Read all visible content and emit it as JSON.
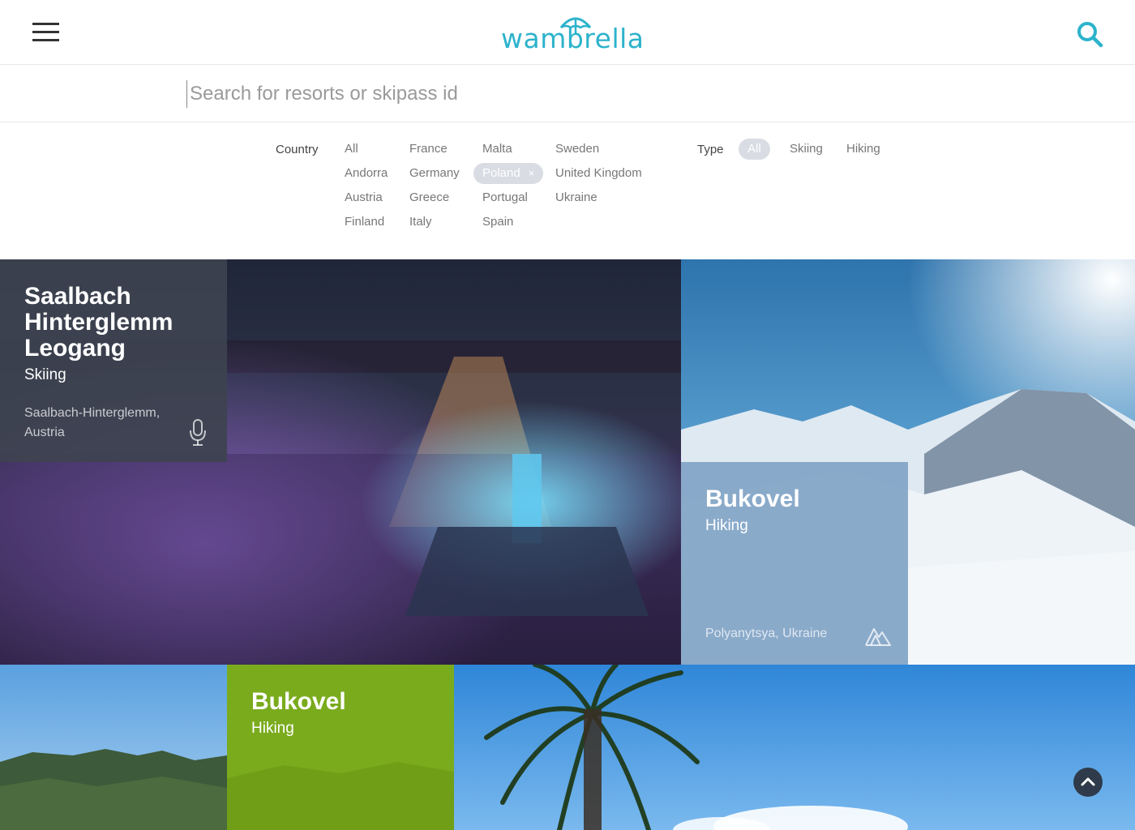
{
  "header": {
    "logo_text": "wambrella",
    "menu_icon": "hamburger-icon",
    "search_icon": "search-icon",
    "accent_color": "#2db3cc"
  },
  "search": {
    "placeholder": "Search for resorts or skipass id",
    "value": ""
  },
  "filters": {
    "country_label": "Country",
    "countries": [
      {
        "label": "All",
        "selected": false
      },
      {
        "label": "Andorra",
        "selected": false
      },
      {
        "label": "Austria",
        "selected": false
      },
      {
        "label": "Finland",
        "selected": false
      },
      {
        "label": "France",
        "selected": false
      },
      {
        "label": "Germany",
        "selected": false
      },
      {
        "label": "Greece",
        "selected": false
      },
      {
        "label": "Italy",
        "selected": false
      },
      {
        "label": "Malta",
        "selected": false
      },
      {
        "label": "Poland",
        "selected": true
      },
      {
        "label": "Portugal",
        "selected": false
      },
      {
        "label": "Spain",
        "selected": false
      },
      {
        "label": "Sweden",
        "selected": false
      },
      {
        "label": "United Kingdom",
        "selected": false
      },
      {
        "label": "Ukraine",
        "selected": false
      }
    ],
    "remove_glyph": "×",
    "type_label": "Type",
    "types": [
      {
        "label": "All",
        "selected": true
      },
      {
        "label": "Skiing",
        "selected": false
      },
      {
        "label": "Hiking",
        "selected": false
      }
    ]
  },
  "resorts": [
    {
      "name": "Saalbach Hinterglemm Leogang",
      "type": "Skiing",
      "location": "Saalbach-Hinterglemm, Austria",
      "icon": "microphone-icon",
      "card_color": "#3d4350"
    },
    {
      "name": "Bukovel",
      "type": "Hiking",
      "location": "Polyanytsya, Ukraine",
      "icon": "mountains-icon",
      "card_color": "#7c9fc3"
    },
    {
      "name": "Bukovel",
      "type": "Hiking",
      "location": "",
      "icon": "",
      "card_color": "#7aab1d"
    }
  ],
  "scroll_top_icon": "chevron-up-icon"
}
